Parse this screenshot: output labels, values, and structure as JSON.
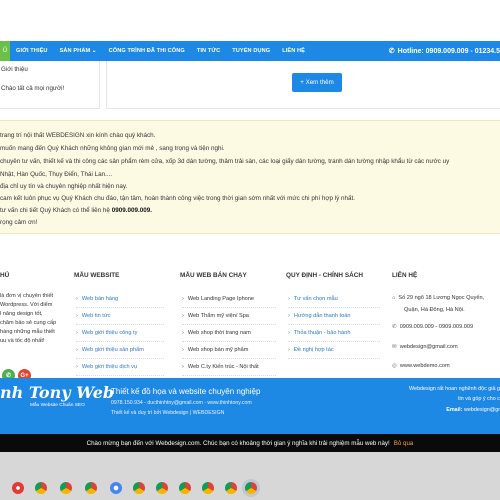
{
  "nav": {
    "items": [
      "GIỚI THIỆU",
      "SẢN PHẨM",
      "CÔNG TRÌNH ĐÃ THI CÔNG",
      "TIN TỨC",
      "TUYỂN DỤNG",
      "LIÊN HỆ"
    ],
    "home_label": "Ủ",
    "dropdown_caret": "⌄",
    "phone_icon": "phone-icon",
    "hotline": "Hotline: 0909.009.009 - 01234.5"
  },
  "top_box": {
    "line1": "Giới thiệu",
    "line2": "Chào tất cả mọi người!",
    "more_button": "+ Xem thêm"
  },
  "intro": {
    "lines": [
      "trang trí nội thất WEBDESIGN xin kính chào quý khách.",
      "muốn mang đến Quý Khách những không gian mới mẻ , sang trọng và tiện nghi.",
      "chuyên tư vấn, thiết kế và thi công các sản phẩm rèm cửa, xốp 3d dán tường, thảm trải sàn, các loại giấy dán tường, tranh dán tường nhập khẩu từ các nước uy",
      "Nhật, Hàn Quốc, Thụy Điển, Thái Lan....",
      "địa chỉ uy tín và chuyên nghiệp nhất hiện nay.",
      "cam kết luôn phục vụ Quý Khách chu đáo, tận tâm, hoàn thành công việc trong thời gian sớm nhất với mức chi phí hợp lý nhất.",
      "tư vấn chi tiết Quý Khách có thể liên hệ",
      "rọng cảm ơn!"
    ],
    "phone_bold": "0909.009.009."
  },
  "footer": {
    "col1_title": "HỦ",
    "about_lines": [
      "là đơn vị chuyên thiết",
      "Wordpress. Với điểm",
      "l năng design tốt,",
      "chăm bảo sẻ cung cấp",
      "hàng những mẫu thiết",
      "uu và tốc độ nhất!"
    ],
    "social": [
      {
        "icon": "phone-icon",
        "glyph": "✆",
        "color": "#4caf50"
      },
      {
        "icon": "google-plus-icon",
        "glyph": "G+",
        "color": "#e0452e"
      }
    ],
    "col2_title": "MẪU WEBSITE",
    "col2_items": [
      "Web bán hàng",
      "Web tin tức",
      "Web giới thiệu công ty",
      "Web giới thiệu sản phẩm",
      "Web giới thiệu dịch vụ"
    ],
    "col3_title": "MẪU WEB BÁN CHẠY",
    "col3_items": [
      "Web Landing Page Iphone",
      "Web Thẩm mỹ viện/ Spa",
      "Web shop thời trang nam",
      "Web shop bán mỹ phẩm",
      "Web C.ty Kiến trúc - Nội thất"
    ],
    "col4_title": "QUY ĐỊNH - CHÍNH SÁCH",
    "col4_items": [
      "Tư vấn chọn mẫu",
      "Hướng dẫn thanh toán",
      "Thỏa thuận - bảo hành",
      "Đề nghị hợp tác"
    ],
    "col5_title": "LIÊN HỆ",
    "address_lines": [
      "Số 29 ngõ 18 Lương Ngọc Quyến,",
      "Quận, Hà Đông, Hà Nội."
    ],
    "phone": "0909.009.009 - 0909.009.009",
    "email": "webdesign@gmail.com",
    "website": "www.webdemo.com"
  },
  "bluefoot": {
    "brand": "nh Tony Web",
    "brand_sub": "Mẫu Website Chuẩn SEO",
    "title": "Thiết kế đồ họa và website chuyên nghiệp",
    "line1": "0978.150.934 - ducthinhtny@gmail.com - www.thinhtony.com",
    "line2": "Thiết kế và duy trì bởi Webdesign | WEBDESIGN",
    "right1": "Webdesign rất hoan nghênh độc giả g",
    "right2": "tin và góp ý cho c",
    "right3_label": "Email:",
    "right3_value": "webdesign@gr"
  },
  "notice": {
    "text": "Chào mừng bạn đến với Webdesign.com. Chúc bạn có khoảng thời gian ý nghĩa khi trải nghiệm mẫu web này!",
    "close": "Bỏ qua"
  },
  "taskbar": {
    "icons": [
      {
        "name": "red-app-icon",
        "color": "#e53935"
      },
      {
        "name": "chrome-icon",
        "color": "#f4b400"
      },
      {
        "name": "chrome-icon-2",
        "color": "#3d8f3d"
      },
      {
        "name": "chrome-icon-3",
        "color": "#f4b400"
      },
      {
        "name": "blue-app-icon",
        "color": "#4285f4"
      },
      {
        "name": "chrome-icon-4",
        "color": "#f4b400"
      },
      {
        "name": "chrome-icon-5",
        "color": "#f4b400"
      },
      {
        "name": "chrome-icon-6",
        "color": "#f4b400"
      },
      {
        "name": "chrome-icon-7",
        "color": "#f4b400"
      },
      {
        "name": "chrome-icon-8",
        "color": "#f4b400"
      },
      {
        "name": "chrome-icon-active",
        "color": "#f4b400"
      }
    ]
  }
}
